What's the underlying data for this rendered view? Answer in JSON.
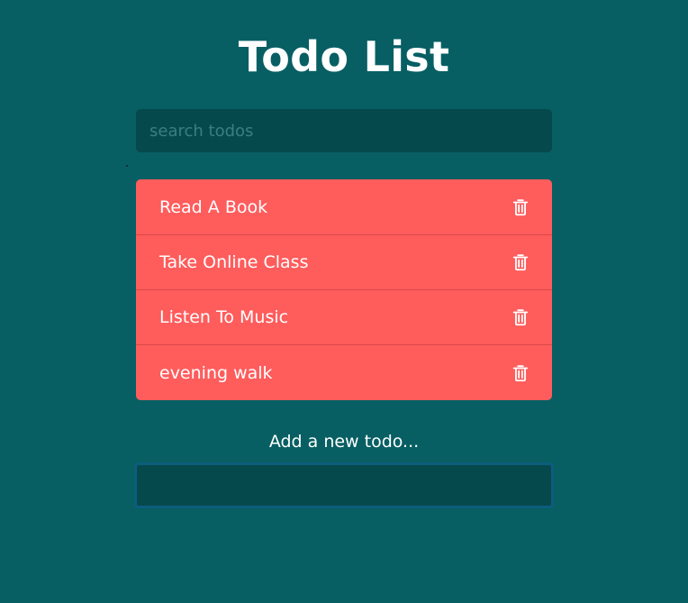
{
  "app": {
    "title": "Todo List"
  },
  "search": {
    "placeholder": "search todos",
    "value": ""
  },
  "todos": [
    {
      "label": "Read A Book",
      "icon": "trash-icon"
    },
    {
      "label": "Take Online Class",
      "icon": "trash-icon"
    },
    {
      "label": "Listen To Music",
      "icon": "trash-icon"
    },
    {
      "label": "evening walk",
      "icon": "trash-icon"
    }
  ],
  "add_todo": {
    "label": "Add a new todo...",
    "value": ""
  },
  "colors": {
    "background": "#075f63",
    "input_background": "#06494d",
    "todo_background": "#ff5c5c",
    "add_input_border": "#0d5d7d",
    "text": "#ffffff"
  }
}
